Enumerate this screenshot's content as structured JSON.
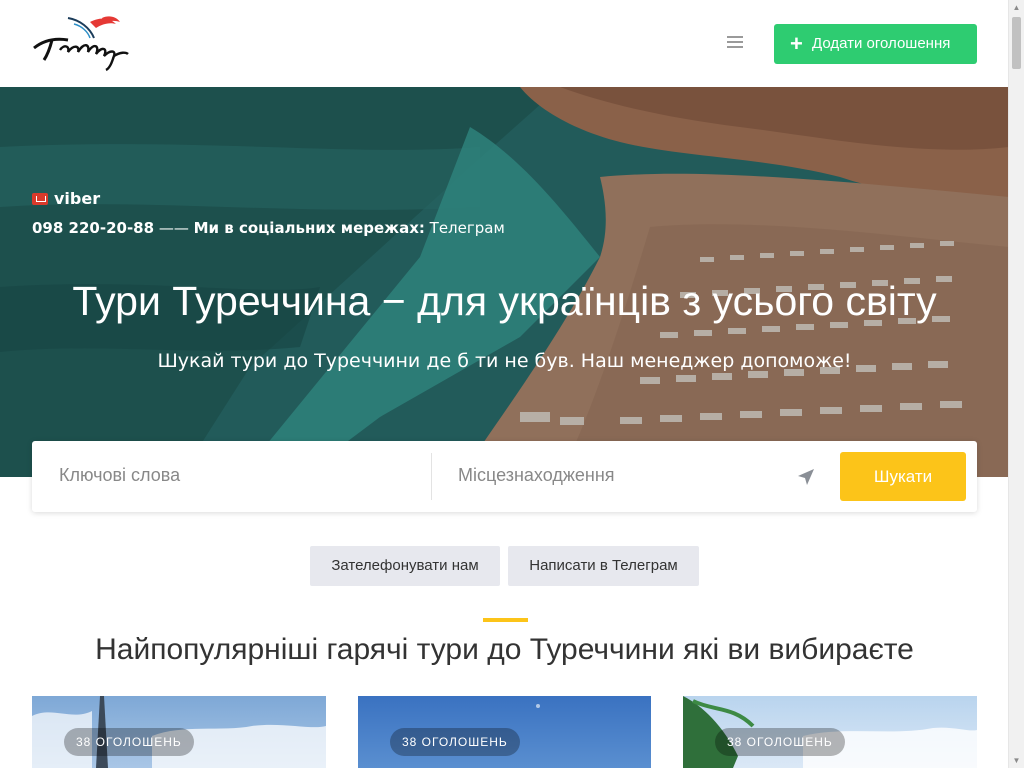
{
  "header": {
    "logo_text": "Türkiye",
    "add_button_label": "Додати оголошення"
  },
  "hero": {
    "viber_label": "viber",
    "phone": "098 220-20-88",
    "separator": "——",
    "social_label": "Ми в соціальних мережах:",
    "social_link": "Телеграм",
    "title": "Тури Туреччина − для українців з усього світу",
    "subtitle": "Шукай тури до Туреччини де б ти не був. Наш менеджер допоможе!"
  },
  "search": {
    "keywords_placeholder": "Ключові слова",
    "location_placeholder": "Місцезнаходження",
    "button_label": "Шукати"
  },
  "contact_buttons": {
    "call_label": "Зателефонувати нам",
    "telegram_label": "Написати в Телеграм"
  },
  "popular": {
    "title": "Найпопулярніші гарячі тури до Туреччини які ви вибираєте",
    "cards": [
      {
        "badge": "38 ОГОЛОШЕНЬ"
      },
      {
        "badge": "38 ОГОЛОШЕНЬ"
      },
      {
        "badge": "38 ОГОЛОШЕНЬ"
      }
    ]
  },
  "colors": {
    "add_button": "#2ecc71",
    "search_button": "#fcc419",
    "accent": "#fcc419",
    "logo_red": "#e53935"
  },
  "icons": [
    "burger-menu-icon",
    "plus-icon",
    "viber-icon",
    "location-arrow-icon"
  ]
}
